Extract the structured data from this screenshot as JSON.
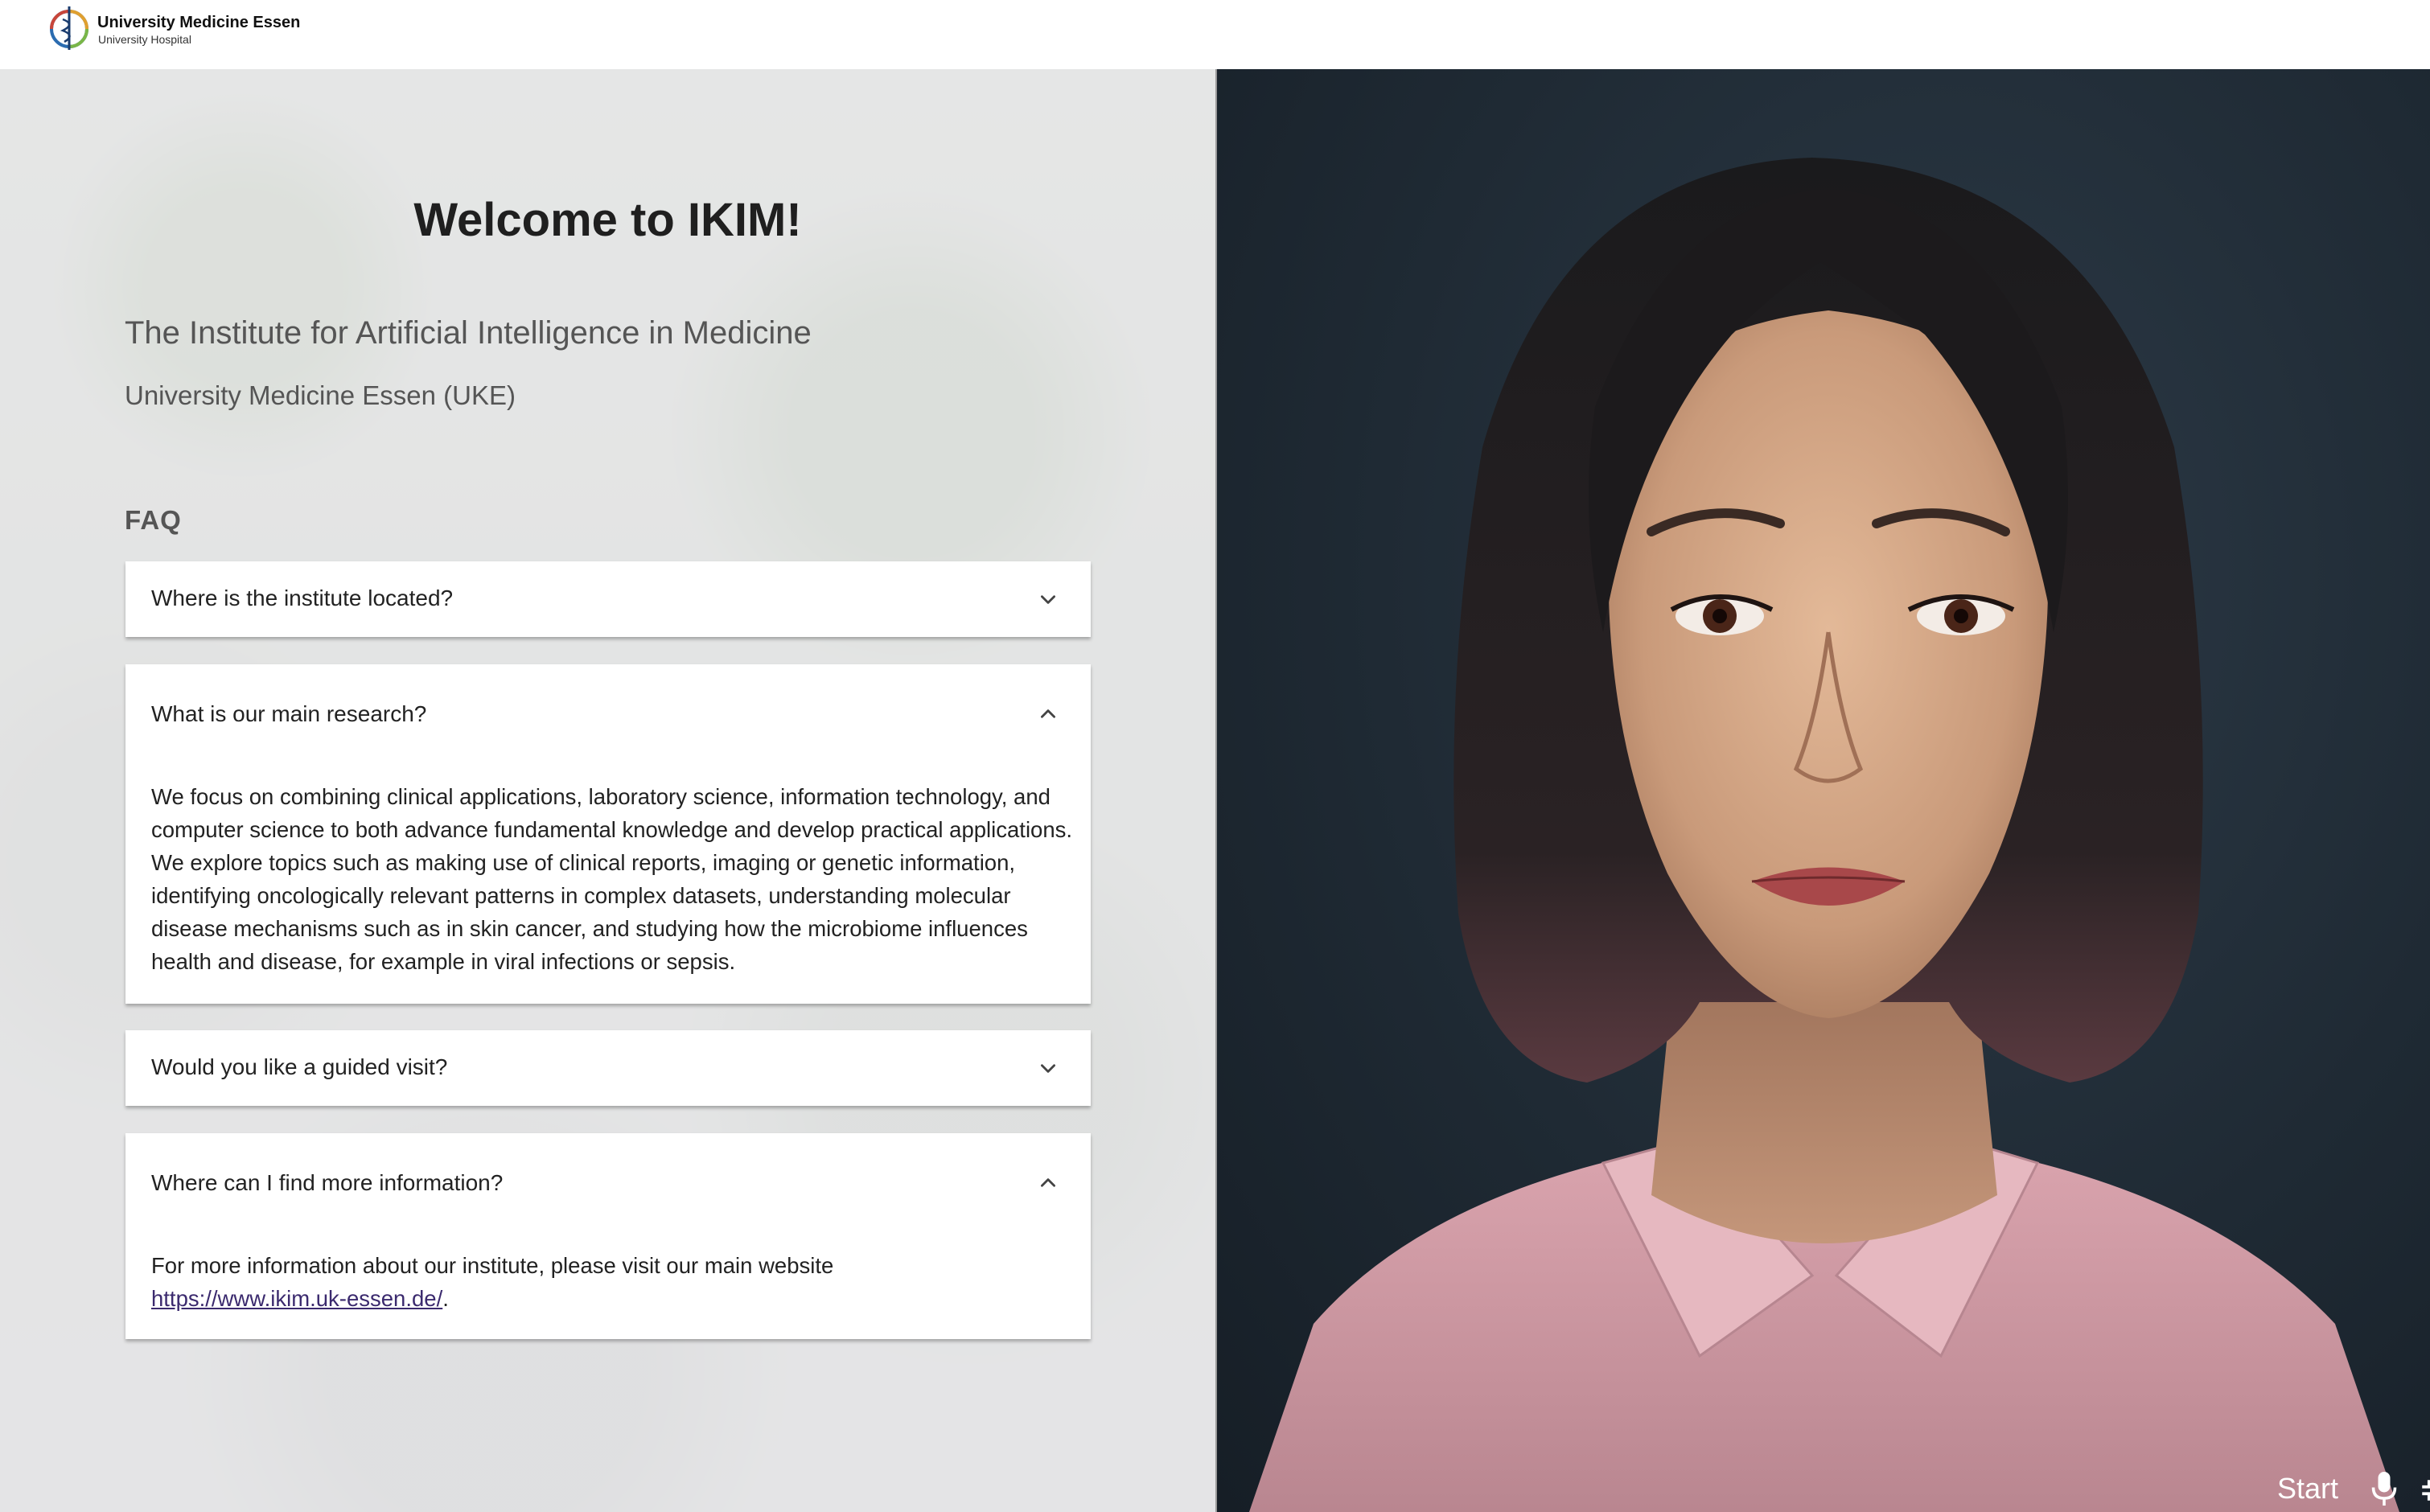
{
  "header": {
    "logo_title": "University Medicine Essen",
    "logo_subtitle": "University Hospital"
  },
  "main": {
    "welcome_title": "Welcome to IKIM!",
    "subtitle_institute": "The Institute for Artificial Intelligence in Medicine",
    "subtitle_university": "University Medicine Essen (UKE)",
    "faq_heading": "FAQ"
  },
  "faq": [
    {
      "question": "Where is the institute located?",
      "expanded": false,
      "chevron": "chevron-down-icon"
    },
    {
      "question": "What is our main research?",
      "expanded": true,
      "chevron": "chevron-up-icon",
      "answer": "We focus on combining clinical applications, laboratory science, information technology, and computer science to both advance fundamental knowledge and develop practical applications. We explore topics such as making use of clinical reports, imaging or genetic information, identifying oncologically relevant patterns in complex datasets, understanding molecular disease mechanisms such as in skin cancer, and studying how the microbiome influences health and disease, for example in viral infections or sepsis."
    },
    {
      "question": "Would you like a guided visit?",
      "expanded": false,
      "chevron": "chevron-down-icon"
    },
    {
      "question": "Where can I find more information?",
      "expanded": true,
      "chevron": "chevron-up-icon",
      "answer_prefix": "For more information about our institute, please visit our main website",
      "answer_link": "https://www.ikim.uk-essen.de/",
      "answer_suffix": "."
    }
  ],
  "avatar_panel": {
    "start_label": "Start",
    "mic_icon": "microphone-icon",
    "shrink_icon": "exit-fullscreen-icon"
  },
  "colors": {
    "link": "#3b2a6e",
    "avatar_bg": "#1f2a34",
    "shirt": "#d9a3ad"
  }
}
